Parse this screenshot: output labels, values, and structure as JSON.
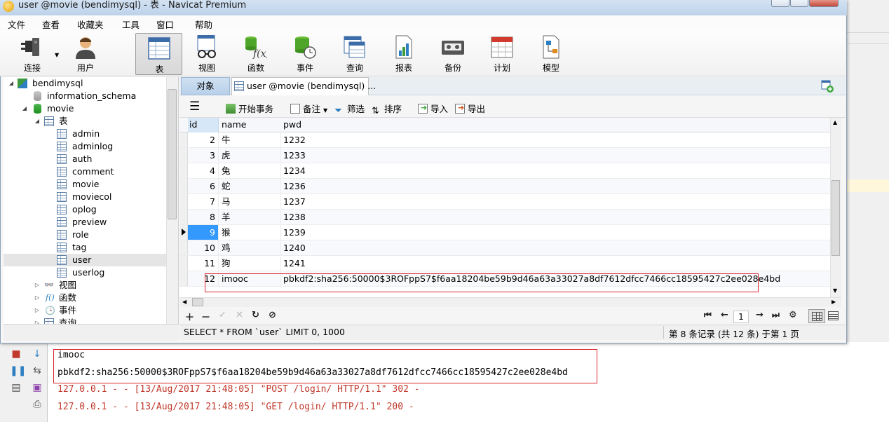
{
  "window": {
    "title": "user @movie (bendimysql) - 表 - Navicat Premium"
  },
  "menu": [
    "文件",
    "查看",
    "收藏夹",
    "工具",
    "窗口",
    "帮助"
  ],
  "toolbar": [
    {
      "label": "连接",
      "icon": "plug-icon"
    },
    {
      "label": "用户",
      "icon": "user-icon"
    },
    {
      "label": "表",
      "icon": "table-icon"
    },
    {
      "label": "视图",
      "icon": "view-glasses-icon"
    },
    {
      "label": "函数",
      "icon": "function-icon"
    },
    {
      "label": "事件",
      "icon": "event-clock-icon"
    },
    {
      "label": "查询",
      "icon": "query-icon"
    },
    {
      "label": "报表",
      "icon": "report-icon"
    },
    {
      "label": "备份",
      "icon": "backup-tape-icon"
    },
    {
      "label": "计划",
      "icon": "calendar-icon"
    },
    {
      "label": "模型",
      "icon": "model-icon"
    }
  ],
  "tree": {
    "connection": "bendimysql",
    "databases": [
      "information_schema",
      "movie"
    ],
    "tables_label": "表",
    "tables": [
      "admin",
      "adminlog",
      "auth",
      "comment",
      "movie",
      "moviecol",
      "oplog",
      "preview",
      "role",
      "tag",
      "user",
      "userlog"
    ],
    "selected_table": "user",
    "views_label": "视图",
    "functions_label": "函数",
    "events_label": "事件",
    "queries_label": "查询"
  },
  "tabs": {
    "objects": "对象",
    "table": "user @movie (bendimysql) ..."
  },
  "data_toolbar": {
    "begin_transaction": "开始事务",
    "memo": "备注",
    "filter": "筛选",
    "sort": "排序",
    "import": "导入",
    "export": "导出"
  },
  "grid": {
    "columns": [
      "id",
      "name",
      "pwd"
    ],
    "rows": [
      {
        "id": "2",
        "name": "牛",
        "pwd": "1232"
      },
      {
        "id": "3",
        "name": "虎",
        "pwd": "1233"
      },
      {
        "id": "4",
        "name": "兔",
        "pwd": "1234"
      },
      {
        "id": "6",
        "name": "蛇",
        "pwd": "1236"
      },
      {
        "id": "7",
        "name": "马",
        "pwd": "1237"
      },
      {
        "id": "8",
        "name": "羊",
        "pwd": "1238"
      },
      {
        "id": "9",
        "name": "猴",
        "pwd": "1239"
      },
      {
        "id": "10",
        "name": "鸡",
        "pwd": "1240"
      },
      {
        "id": "11",
        "name": "狗",
        "pwd": "1241"
      },
      {
        "id": "12",
        "name": "imooc",
        "pwd": "pbkdf2:sha256:50000$3ROFppS7$f6aa18204be59b9d46a63a33027a8df7612dfcc7466cc18595427c2ee028e4bd"
      }
    ],
    "current_row_id": "9"
  },
  "navigation": {
    "page": "1"
  },
  "status": {
    "sql": "SELECT * FROM `user` LIMIT 0, 1000",
    "records": "第 8 条记录 (共 12 条) 于第 1 页"
  },
  "console": {
    "lines": [
      "imooc",
      "pbkdf2:sha256:50000$3ROFppS7$f6aa18204be59b9d46a63a33027a8df7612dfcc7466cc18595427c2ee028e4bd",
      "127.0.0.1 - - [13/Aug/2017 21:48:05] \"POST /login/ HTTP/1.1\" 302 -",
      "127.0.0.1 - - [13/Aug/2017 21:48:05] \"GET /login/ HTTP/1.1\" 200 -"
    ]
  },
  "colors": {
    "highlight_box": "#d9262f",
    "selected_cell": "#3399ff",
    "log_red": "#c0392b"
  }
}
